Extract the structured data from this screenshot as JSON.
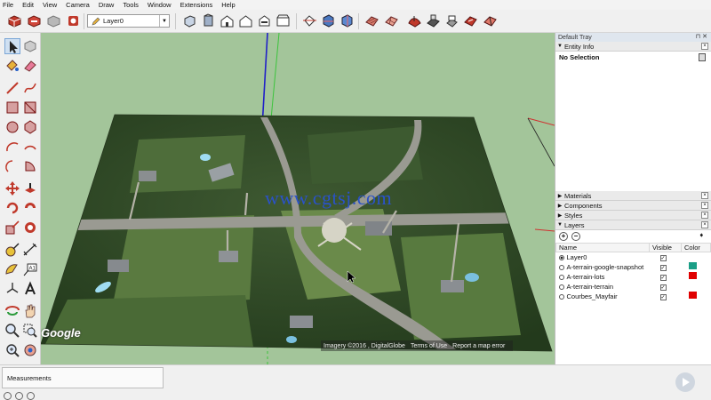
{
  "menu": [
    "File",
    "Edit",
    "View",
    "Camera",
    "Draw",
    "Tools",
    "Window",
    "Extensions",
    "Help"
  ],
  "toolbar": {
    "layer_current": "Layer0",
    "icons": [
      "get-models-icon",
      "share-model-icon",
      "share-component-icon",
      "extension-warehouse-icon",
      "iso-view-icon",
      "top-view-icon",
      "front-view-icon",
      "right-view-icon",
      "back-view-icon",
      "left-view-icon",
      "section-plane-icon",
      "display-section-planes-icon",
      "display-section-cuts-icon",
      "sandbox-from-contours-icon",
      "sandbox-from-scratch-icon",
      "smoove-icon",
      "stamp-icon",
      "drape-icon",
      "add-detail-icon"
    ]
  },
  "viewport": {
    "watermark": "www.cgtsj.com",
    "google_logo": "Google",
    "attribution": [
      "Imagery ©2016 , DigitalGlobe",
      "Terms of Use",
      "Report a map error"
    ]
  },
  "tray": {
    "title": "Default Tray",
    "entity_info": {
      "header": "Entity Info",
      "selection": "No Selection"
    },
    "panels": [
      "Materials",
      "Components",
      "Styles"
    ],
    "layers": {
      "header": "Layers",
      "columns": [
        "Name",
        "Visible",
        "Color"
      ],
      "rows": [
        {
          "name": "Layer0",
          "active": true,
          "visible": true,
          "color": ""
        },
        {
          "name": "A-terrain-google-snapshot",
          "active": false,
          "visible": true,
          "color": "#1a9e86"
        },
        {
          "name": "A-terrain-lots",
          "active": false,
          "visible": true,
          "color": "#e00000"
        },
        {
          "name": "A-terrain-terrain",
          "active": false,
          "visible": true,
          "color": ""
        },
        {
          "name": "Courbes_Mayfair",
          "active": false,
          "visible": true,
          "color": "#e00000"
        }
      ]
    }
  },
  "status": {
    "measurements_label": "Measurements"
  },
  "colors": {
    "sky_ground": "#a3c59a",
    "red_axis": "#d03030",
    "green_axis": "#3cc43c",
    "blue_axis": "#2020c8"
  }
}
